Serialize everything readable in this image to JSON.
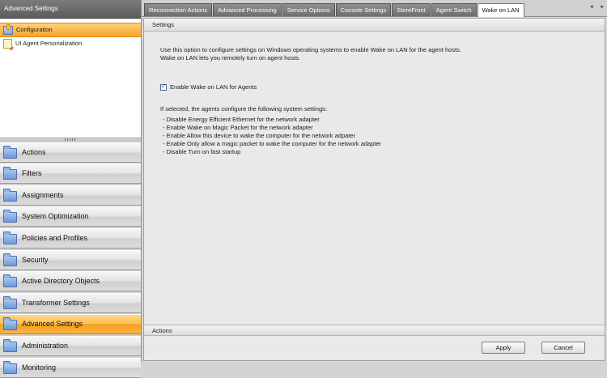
{
  "left_panel": {
    "header": "Advanced Settings",
    "tree": [
      {
        "label": "Configuration",
        "icon": "configuration-icon",
        "selected": true
      },
      {
        "label": "UI Agent Personalization",
        "icon": "ui-personalization-icon",
        "selected": false
      }
    ]
  },
  "nav": [
    {
      "label": "Actions",
      "active": false
    },
    {
      "label": "Filters",
      "active": false
    },
    {
      "label": "Assignments",
      "active": false
    },
    {
      "label": "System Optimization",
      "active": false
    },
    {
      "label": "Policies and Profiles",
      "active": false
    },
    {
      "label": "Security",
      "active": false
    },
    {
      "label": "Active Directory Objects",
      "active": false
    },
    {
      "label": "Transformer Settings",
      "active": false
    },
    {
      "label": "Advanced Settings",
      "active": true
    },
    {
      "label": "Administration",
      "active": false
    },
    {
      "label": "Monitoring",
      "active": false
    }
  ],
  "tabs": [
    {
      "label": "Reconnection Actions",
      "active": false
    },
    {
      "label": "Advanced Processing",
      "active": false
    },
    {
      "label": "Service Options",
      "active": false
    },
    {
      "label": "Console Settings",
      "active": false
    },
    {
      "label": "StoreFront",
      "active": false
    },
    {
      "label": "Agent Switch",
      "active": false
    },
    {
      "label": "Wake on LAN",
      "active": true
    }
  ],
  "settings": {
    "header": "Settings",
    "description_line1": "Use this option to configure settings on Windows operating systems to enable Wake on LAN for the agent hosts.",
    "description_line2": "Wake on LAN lets you remotely turn on agent hosts.",
    "checkbox_label": "Enable Wake on LAN for Agents",
    "checkbox_checked": true,
    "intro": "If selected, the agents configure the following system settings:",
    "bullets": [
      "- Disable Energy Efficient Ethernet for the network adapter",
      "- Enable Wake on Magic Packet for the network adapter",
      "- Enable Allow this device to wake the computer for the network adpater",
      "- Enable Only allow a magic packet to wake the computer for the network adapter",
      "- Disable Turn on fast startup"
    ]
  },
  "actions": {
    "header": "Actions",
    "apply_label": "Apply",
    "cancel_label": "Cancel"
  },
  "colors": {
    "active_orange": "#f7a52c",
    "header_gray": "#6a6a6a"
  }
}
